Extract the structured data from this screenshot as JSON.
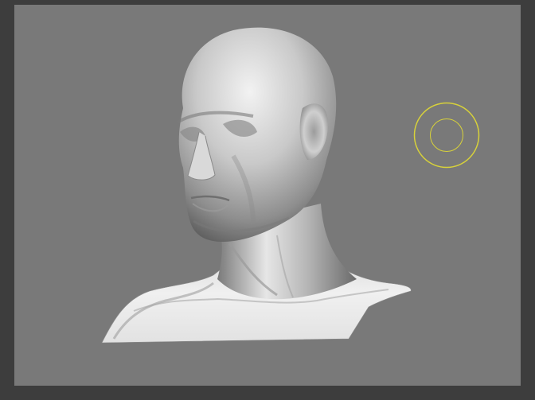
{
  "app": {
    "viewport": {
      "model": {
        "name": "",
        "shading": "matcap-gray"
      },
      "brush_cursor": {
        "color": "#d8d23a",
        "shape": "dual-circle"
      },
      "background_color": "#797979",
      "frame_color": "#3d3d3d"
    }
  }
}
